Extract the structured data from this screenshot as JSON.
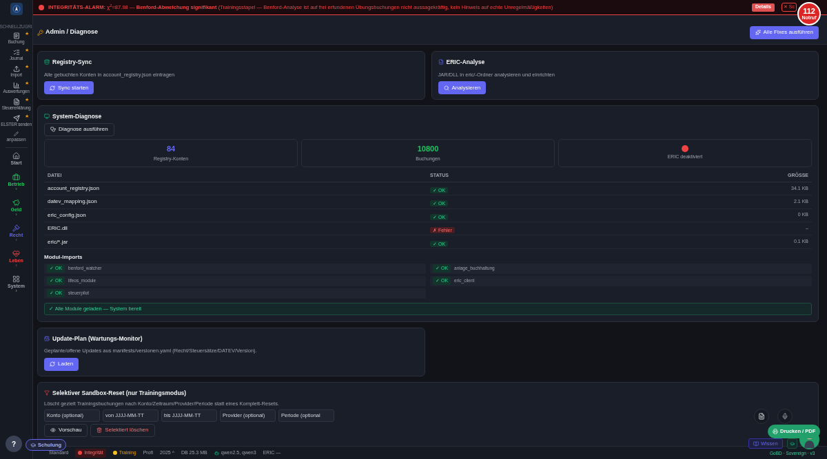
{
  "sidebar": {
    "section_label": "SCHNELLZUGRI",
    "quick_items": [
      {
        "label": "Buchung",
        "starred": true
      },
      {
        "label": "Journal",
        "starred": true
      },
      {
        "label": "Import",
        "starred": true
      },
      {
        "label": "Auswertungen",
        "starred": true
      },
      {
        "label": "Steuererklärung",
        "starred": true
      },
      {
        "label": "ELSTER senden",
        "starred": true
      }
    ],
    "star": "★",
    "customize_label": "anpassen",
    "nav_items": [
      {
        "label": "Start",
        "color": "#9ca3af",
        "has_submenu": false
      },
      {
        "label": "Betrieb",
        "color": "#22c55e",
        "has_submenu": true
      },
      {
        "label": "Geld",
        "color": "#22c55e",
        "has_submenu": true
      },
      {
        "label": "Recht",
        "color": "#6366f1",
        "has_submenu": true
      },
      {
        "label": "Leben",
        "color": "#ef4444",
        "has_submenu": true
      },
      {
        "label": "System",
        "color": "#9ca3af",
        "has_submenu": true
      }
    ],
    "chevron": "›"
  },
  "alarm": {
    "text": "**INTEGRITÄTS-ALARM:** χ$^{2}$=87.98 — **Benford-Abweichung signifikant** (Trainingsstapel — Benford-Analyse ist auf frei erfundenen Übungsbuchungen nicht aussagekräftig, kein Hinweis auf echte Unregelmäßigkeiten)",
    "details_button": "Details",
    "close_button": "✕ Sc",
    "emergency": {
      "number": "112",
      "label": "Notruf"
    }
  },
  "header": {
    "title": "Admin / Diagnose",
    "action_button": "Alle Fixes ausführen"
  },
  "tool_cards": [
    {
      "title": "Registry-Sync",
      "description": "Alle gebuchten Konten in account_registry.json eintragen",
      "button": "Sync starten"
    },
    {
      "title": "ERIC-Analyse",
      "description": "JAR/DLL in eric/-Ordner analysieren und einrichten",
      "button": "Analysieren"
    }
  ],
  "diagnose": {
    "title": "System-Diagnose",
    "run_button": "Diagnose ausführen",
    "stats": [
      {
        "kind": "number",
        "value": "84",
        "label": "Registry-Konten",
        "color": "#6366f1"
      },
      {
        "kind": "number",
        "value": "10800",
        "label": "Buchungen",
        "color": "#22c55e"
      },
      {
        "kind": "dot",
        "label": "ERIC deaktiviert",
        "color": "#ef4444"
      }
    ],
    "table": {
      "columns": [
        "DATEI",
        "STATUS",
        "GRÖSSE"
      ],
      "rows": [
        {
          "file": "account_registry.json",
          "ok": true,
          "status": "✓ OK",
          "size": "34.1 KB"
        },
        {
          "file": "datev_mapping.json",
          "ok": true,
          "status": "✓ OK",
          "size": "2.1 KB"
        },
        {
          "file": "eric_config.json",
          "ok": true,
          "status": "✓ OK",
          "size": "0 KB"
        },
        {
          "file": "ERiC.dll",
          "ok": false,
          "status": "✗ Fehler",
          "size": "–"
        },
        {
          "file": "eric/*.jar",
          "ok": true,
          "status": "✓ OK",
          "size": "0.1 KB"
        }
      ]
    },
    "modules_title": "Modul-Imports",
    "modules": [
      {
        "name": "benford_watcher",
        "ok": true,
        "status": "✓ OK"
      },
      {
        "name": "anlage_buchhaltung",
        "ok": true,
        "status": "✓ OK"
      },
      {
        "name": "lifeos_module",
        "ok": true,
        "status": "✓ OK"
      },
      {
        "name": "eric_client",
        "ok": true,
        "status": "✓ OK"
      },
      {
        "name": "steuerpilot",
        "ok": true,
        "status": "✓ OK"
      }
    ],
    "result": "✓ Alle Module geladen — System bereit"
  },
  "update_plan": {
    "title": "Update-Plan (Wartungs-Monitor)",
    "description": "Geplante/offene Updates aus manifests/versionen.yaml (Recht/Steuersätze/DATEV/Version).",
    "button": "Laden"
  },
  "sandbox_reset": {
    "title": "Selektiver Sandbox-Reset (nur Trainingsmodus)",
    "description": "Löscht gezielt Trainingsbuchungen nach Konto/Zeitraum/Provider/Periode statt eines Komplett-Resets.",
    "fields": [
      {
        "placeholder": "Konto (optional)"
      },
      {
        "placeholder": "von JJJJ-MM-TT"
      },
      {
        "placeholder": "bis JJJJ-MM-TT"
      },
      {
        "placeholder": "Provider (optional)"
      },
      {
        "placeholder": "Periode (optional"
      }
    ],
    "preview_button": "Vorschau",
    "delete_button": "Selektiert löschen"
  },
  "status_bar": {
    "items": [
      {
        "kind": "plain",
        "label": "Standard"
      },
      {
        "kind": "alert",
        "label": "Integrität"
      },
      {
        "kind": "warning",
        "label": "Training"
      },
      {
        "kind": "plain",
        "label": "Profi"
      },
      {
        "kind": "plain",
        "label": "2025 ^"
      },
      {
        "kind": "plain",
        "label": "DB 25.3 MB"
      },
      {
        "kind": "model",
        "label": "qwen2.5, qwen3"
      },
      {
        "kind": "plain",
        "label": "ERIC —"
      }
    ]
  },
  "floating": {
    "help_button": "?",
    "training_button": "Schulung",
    "print_button": "Drucken / PDF",
    "knowledge_button": "Wissen",
    "footer_text": "GoBD · Sovereign · v3"
  }
}
